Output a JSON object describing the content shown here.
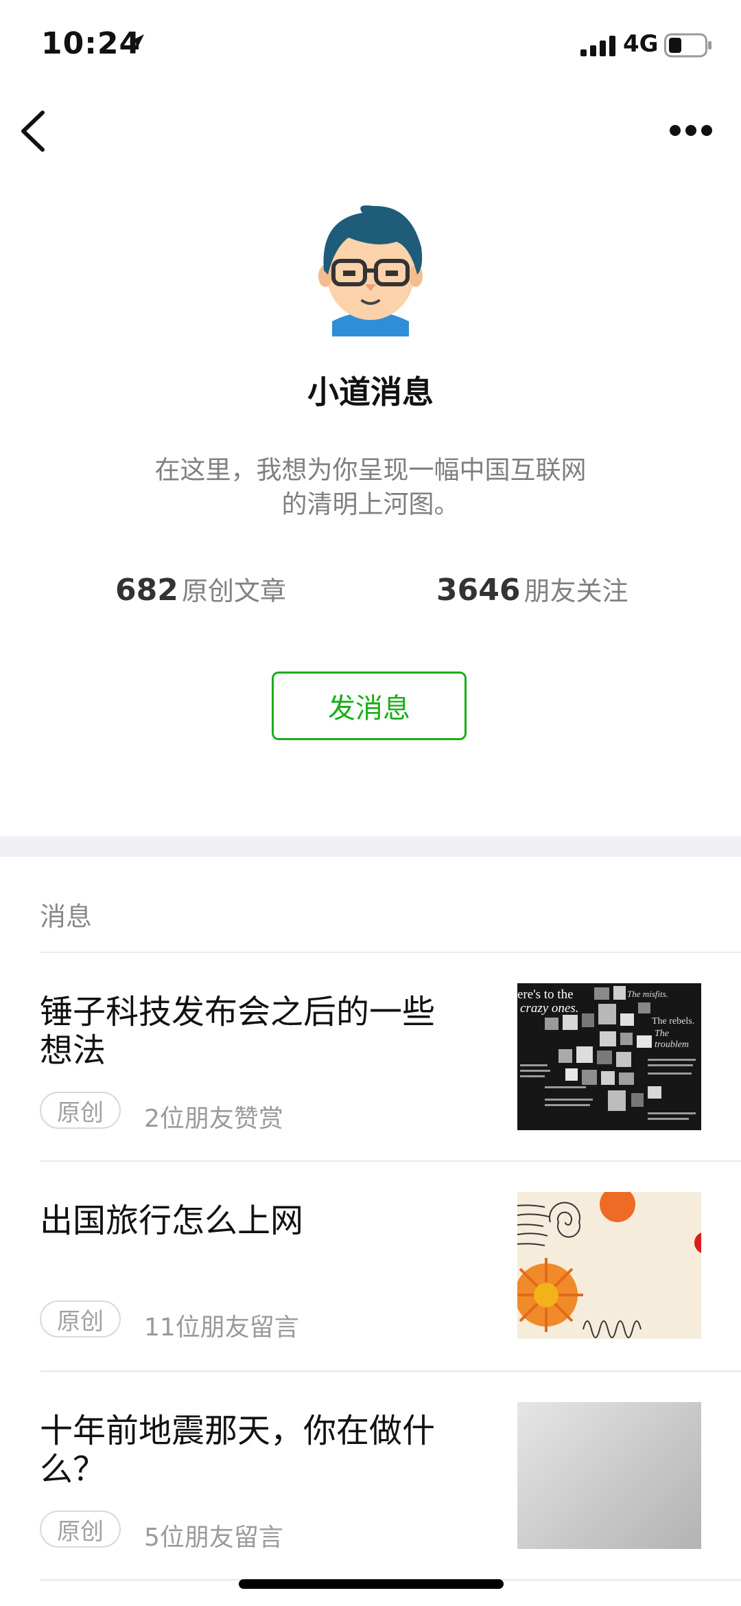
{
  "status_bar": {
    "time": "10:24",
    "network": "4G"
  },
  "profile": {
    "name": "小道消息",
    "description_line1": "在这里，我想为你呈现一幅中国互联网",
    "description_line2": "的清明上河图。",
    "stats": [
      {
        "number": "682",
        "label": "原创文章"
      },
      {
        "number": "3646",
        "label": "朋友关注"
      }
    ],
    "message_button": "发消息"
  },
  "section_title": "消息",
  "articles": [
    {
      "title": "锤子科技发布会之后的一些想法",
      "badge": "原创",
      "meta": "2位朋友赞赏",
      "thumb_text1": "ere's to the",
      "thumb_text2": "crazy ones.",
      "thumb_text3": "The misfits.",
      "thumb_text4": "The rebels.",
      "thumb_text5": "The troublem"
    },
    {
      "title": "出国旅行怎么上网",
      "badge": "原创",
      "meta": "11位朋友留言"
    },
    {
      "title": "十年前地震那天，你在做什么？",
      "badge": "原创",
      "meta": "5位朋友留言"
    }
  ],
  "colors": {
    "accent": "#1aad19",
    "divider_band": "#efeff4"
  }
}
